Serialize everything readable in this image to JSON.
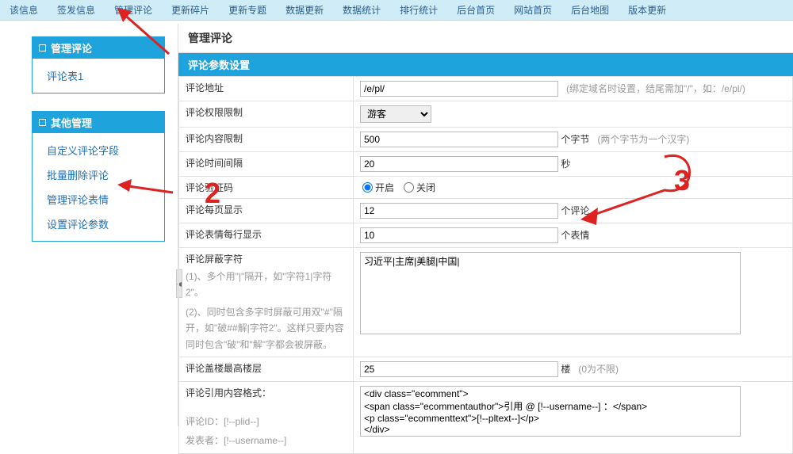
{
  "topnav": {
    "items": [
      "该信息",
      "签发信息",
      "管理评论",
      "更新碎片",
      "更新专题",
      "数据更新",
      "数据统计",
      "排行统计",
      "后台首页",
      "网站首页",
      "后台地图",
      "版本更新"
    ]
  },
  "left": {
    "panel1": {
      "title": "管理评论",
      "items": [
        "评论表1"
      ]
    },
    "panel2": {
      "title": "其他管理",
      "items": [
        "自定义评论字段",
        "批量删除评论",
        "管理评论表情",
        "设置评论参数"
      ]
    }
  },
  "main": {
    "title": "管理评论",
    "bar": "评论参数设置",
    "rows": {
      "addr": {
        "label": "评论地址",
        "value": "/e/pl/",
        "hint": "(绑定域名时设置，结尾需加\"/\"，如：/e/pl/)"
      },
      "perm": {
        "label": "评论权限限制",
        "value": "游客"
      },
      "content": {
        "label": "评论内容限制",
        "value": "500",
        "unit": "个字节",
        "hint2": "(两个字节为一个汉字)"
      },
      "interval": {
        "label": "评论时间间隔",
        "value": "20",
        "unit": "秒"
      },
      "captcha": {
        "label": "评论验证码",
        "opt_on": "开启",
        "opt_off": "关闭"
      },
      "perpage": {
        "label": "评论每页显示",
        "value": "12",
        "unit": "个评论"
      },
      "faceline": {
        "label": "评论表情每行显示",
        "value": "10",
        "unit": "个表情"
      },
      "block": {
        "label": "评论屏蔽字符",
        "help1": "(1)、多个用\"|\"隔开，如\"字符1|字符2\"。",
        "help2": "(2)、同时包含多字时屏蔽可用双\"#\"隔开，如\"破##解|字符2\"。这样只要内容同时包含\"破\"和\"解\"字都会被屏蔽。",
        "value": "习近平|主席|美腿|中国|"
      },
      "floor": {
        "label": "评论盖楼最高楼层",
        "value": "25",
        "unit": "楼",
        "hint2": "(0为不限)"
      },
      "quote": {
        "label": "评论引用内容格式：",
        "help1": "评论ID：[!--plid--]",
        "help2": "发表者：[!--username--]",
        "value": "<div class=\"ecomment\">\n<span class=\"ecommentauthor\">引用 @ [!--username--] ：</span>\n<p class=\"ecommenttext\">[!--pltext--]</p>\n</div>"
      }
    }
  }
}
